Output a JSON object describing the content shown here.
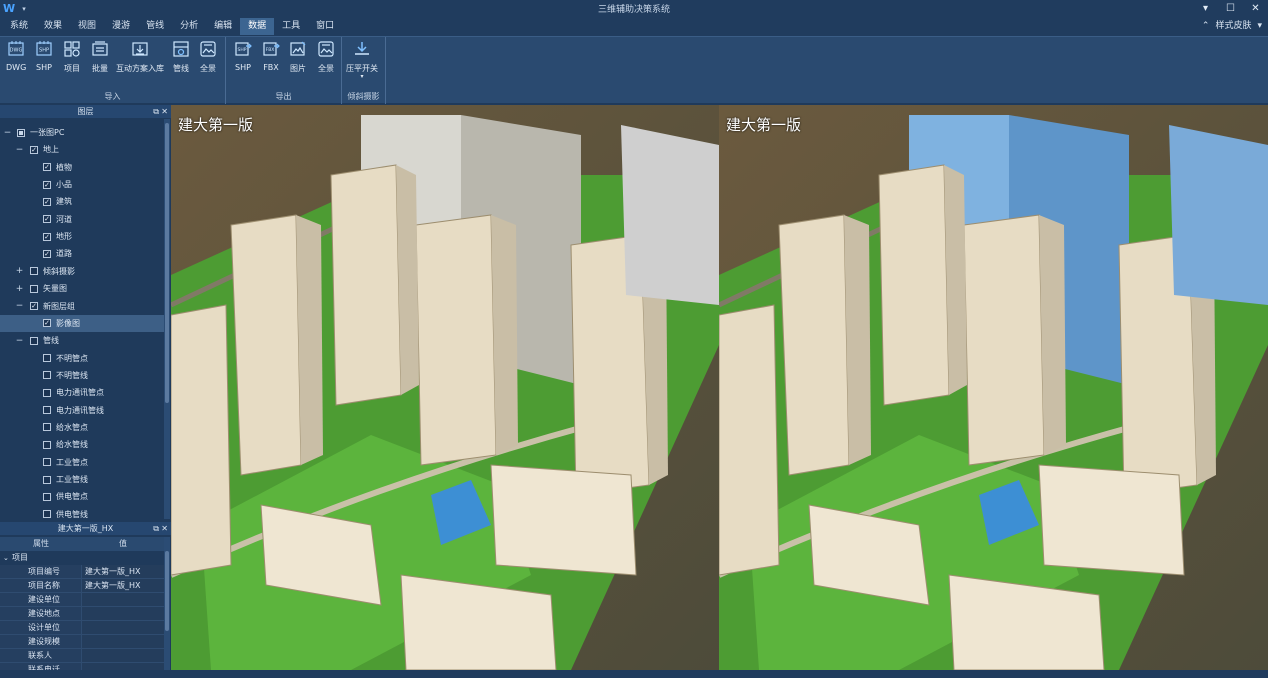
{
  "window": {
    "title": "三维辅助决策系统",
    "controls": [
      "▾",
      "☐",
      "✕"
    ]
  },
  "menu": {
    "items": [
      "系统",
      "效果",
      "视图",
      "漫游",
      "管线",
      "分析",
      "编辑",
      "数据",
      "工具",
      "窗口"
    ],
    "active": "数据",
    "skin_label": "样式皮肤"
  },
  "ribbon": {
    "groups": [
      {
        "label": "导入",
        "buttons": [
          {
            "label": "DWG",
            "icon": "dwg-file-icon"
          },
          {
            "label": "SHP",
            "icon": "shp-file-icon"
          },
          {
            "label": "项目",
            "icon": "project-icon"
          },
          {
            "label": "批量",
            "icon": "batch-icon"
          },
          {
            "label": "互动方案入库",
            "icon": "scheme-import-icon"
          },
          {
            "label": "管线",
            "icon": "pipeline-icon"
          },
          {
            "label": "全景",
            "icon": "panorama-icon"
          }
        ]
      },
      {
        "label": "导出",
        "buttons": [
          {
            "label": "SHP",
            "icon": "shp-export-icon"
          },
          {
            "label": "FBX",
            "icon": "fbx-export-icon"
          },
          {
            "label": "图片",
            "icon": "image-export-icon"
          },
          {
            "label": "全景",
            "icon": "panorama-export-icon"
          }
        ]
      },
      {
        "label": "倾斜摄影",
        "buttons": [
          {
            "label": "压平开关",
            "icon": "flatten-icon"
          }
        ]
      }
    ]
  },
  "layers_panel": {
    "title": "图层",
    "tree": [
      {
        "label": "一张图PC",
        "level": 0,
        "expander": "−",
        "check": "partial"
      },
      {
        "label": "地上",
        "level": 1,
        "expander": "−",
        "check": "checked"
      },
      {
        "label": "植物",
        "level": 2,
        "expander": "",
        "check": "checked"
      },
      {
        "label": "小品",
        "level": 2,
        "expander": "",
        "check": "checked"
      },
      {
        "label": "建筑",
        "level": 2,
        "expander": "",
        "check": "checked"
      },
      {
        "label": "河道",
        "level": 2,
        "expander": "",
        "check": "checked"
      },
      {
        "label": "地形",
        "level": 2,
        "expander": "",
        "check": "checked"
      },
      {
        "label": "道路",
        "level": 2,
        "expander": "",
        "check": "checked"
      },
      {
        "label": "倾斜摄影",
        "level": 1,
        "expander": "+",
        "check": "unchecked"
      },
      {
        "label": "矢量图",
        "level": 1,
        "expander": "+",
        "check": "unchecked"
      },
      {
        "label": "新图层组",
        "level": 1,
        "expander": "−",
        "check": "checked"
      },
      {
        "label": "影像图",
        "level": 2,
        "expander": "",
        "check": "checked",
        "selected": true
      },
      {
        "label": "管线",
        "level": 1,
        "expander": "−",
        "check": "unchecked"
      },
      {
        "label": "不明管点",
        "level": 2,
        "expander": "",
        "check": "unchecked"
      },
      {
        "label": "不明管线",
        "level": 2,
        "expander": "",
        "check": "unchecked"
      },
      {
        "label": "电力通讯管点",
        "level": 2,
        "expander": "",
        "check": "unchecked"
      },
      {
        "label": "电力通讯管线",
        "level": 2,
        "expander": "",
        "check": "unchecked"
      },
      {
        "label": "给水管点",
        "level": 2,
        "expander": "",
        "check": "unchecked"
      },
      {
        "label": "给水管线",
        "level": 2,
        "expander": "",
        "check": "unchecked"
      },
      {
        "label": "工业管点",
        "level": 2,
        "expander": "",
        "check": "unchecked"
      },
      {
        "label": "工业管线",
        "level": 2,
        "expander": "",
        "check": "unchecked"
      },
      {
        "label": "供电管点",
        "level": 2,
        "expander": "",
        "check": "unchecked"
      },
      {
        "label": "供电管线",
        "level": 2,
        "expander": "",
        "check": "unchecked"
      }
    ]
  },
  "properties_panel": {
    "title": "建大第一版_HX",
    "col_property": "属性",
    "col_value": "值",
    "category": "项目",
    "rows": [
      {
        "key": "项目编号",
        "value": "建大第一版_HX"
      },
      {
        "key": "项目名称",
        "value": "建大第一版_HX"
      },
      {
        "key": "建设单位",
        "value": ""
      },
      {
        "key": "建设地点",
        "value": ""
      },
      {
        "key": "设计单位",
        "value": ""
      },
      {
        "key": "建设规模",
        "value": ""
      },
      {
        "key": "联系人",
        "value": ""
      },
      {
        "key": "联系电话",
        "value": ""
      }
    ]
  },
  "viewports": {
    "left_label": "建大第一版",
    "right_label": "建大第一版"
  },
  "colors": {
    "chrome_dark": "#203c5e",
    "ribbon": "#2a4a70",
    "panel_bg": "#1f3a5b",
    "selection": "#3d5f86",
    "accent": "#4aa3ff"
  }
}
